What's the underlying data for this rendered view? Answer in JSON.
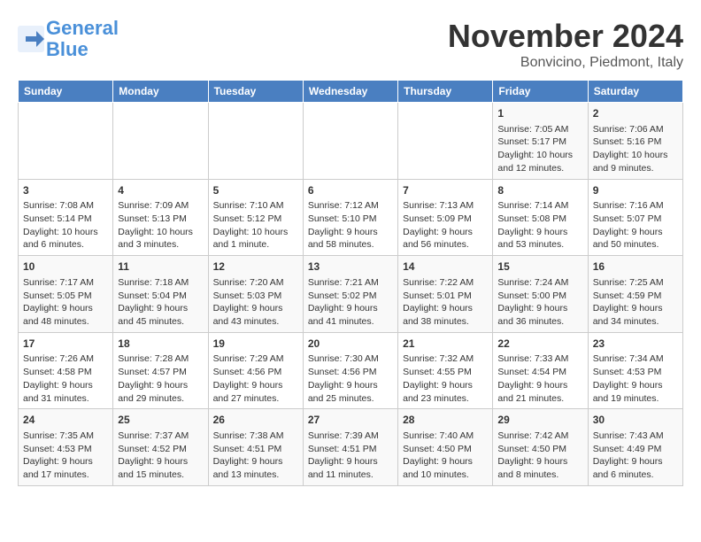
{
  "header": {
    "logo_line1": "General",
    "logo_line2": "Blue",
    "title": "November 2024",
    "subtitle": "Bonvicino, Piedmont, Italy"
  },
  "weekdays": [
    "Sunday",
    "Monday",
    "Tuesday",
    "Wednesday",
    "Thursday",
    "Friday",
    "Saturday"
  ],
  "weeks": [
    [
      {
        "day": "",
        "info": ""
      },
      {
        "day": "",
        "info": ""
      },
      {
        "day": "",
        "info": ""
      },
      {
        "day": "",
        "info": ""
      },
      {
        "day": "",
        "info": ""
      },
      {
        "day": "1",
        "info": "Sunrise: 7:05 AM\nSunset: 5:17 PM\nDaylight: 10 hours and 12 minutes."
      },
      {
        "day": "2",
        "info": "Sunrise: 7:06 AM\nSunset: 5:16 PM\nDaylight: 10 hours and 9 minutes."
      }
    ],
    [
      {
        "day": "3",
        "info": "Sunrise: 7:08 AM\nSunset: 5:14 PM\nDaylight: 10 hours and 6 minutes."
      },
      {
        "day": "4",
        "info": "Sunrise: 7:09 AM\nSunset: 5:13 PM\nDaylight: 10 hours and 3 minutes."
      },
      {
        "day": "5",
        "info": "Sunrise: 7:10 AM\nSunset: 5:12 PM\nDaylight: 10 hours and 1 minute."
      },
      {
        "day": "6",
        "info": "Sunrise: 7:12 AM\nSunset: 5:10 PM\nDaylight: 9 hours and 58 minutes."
      },
      {
        "day": "7",
        "info": "Sunrise: 7:13 AM\nSunset: 5:09 PM\nDaylight: 9 hours and 56 minutes."
      },
      {
        "day": "8",
        "info": "Sunrise: 7:14 AM\nSunset: 5:08 PM\nDaylight: 9 hours and 53 minutes."
      },
      {
        "day": "9",
        "info": "Sunrise: 7:16 AM\nSunset: 5:07 PM\nDaylight: 9 hours and 50 minutes."
      }
    ],
    [
      {
        "day": "10",
        "info": "Sunrise: 7:17 AM\nSunset: 5:05 PM\nDaylight: 9 hours and 48 minutes."
      },
      {
        "day": "11",
        "info": "Sunrise: 7:18 AM\nSunset: 5:04 PM\nDaylight: 9 hours and 45 minutes."
      },
      {
        "day": "12",
        "info": "Sunrise: 7:20 AM\nSunset: 5:03 PM\nDaylight: 9 hours and 43 minutes."
      },
      {
        "day": "13",
        "info": "Sunrise: 7:21 AM\nSunset: 5:02 PM\nDaylight: 9 hours and 41 minutes."
      },
      {
        "day": "14",
        "info": "Sunrise: 7:22 AM\nSunset: 5:01 PM\nDaylight: 9 hours and 38 minutes."
      },
      {
        "day": "15",
        "info": "Sunrise: 7:24 AM\nSunset: 5:00 PM\nDaylight: 9 hours and 36 minutes."
      },
      {
        "day": "16",
        "info": "Sunrise: 7:25 AM\nSunset: 4:59 PM\nDaylight: 9 hours and 34 minutes."
      }
    ],
    [
      {
        "day": "17",
        "info": "Sunrise: 7:26 AM\nSunset: 4:58 PM\nDaylight: 9 hours and 31 minutes."
      },
      {
        "day": "18",
        "info": "Sunrise: 7:28 AM\nSunset: 4:57 PM\nDaylight: 9 hours and 29 minutes."
      },
      {
        "day": "19",
        "info": "Sunrise: 7:29 AM\nSunset: 4:56 PM\nDaylight: 9 hours and 27 minutes."
      },
      {
        "day": "20",
        "info": "Sunrise: 7:30 AM\nSunset: 4:56 PM\nDaylight: 9 hours and 25 minutes."
      },
      {
        "day": "21",
        "info": "Sunrise: 7:32 AM\nSunset: 4:55 PM\nDaylight: 9 hours and 23 minutes."
      },
      {
        "day": "22",
        "info": "Sunrise: 7:33 AM\nSunset: 4:54 PM\nDaylight: 9 hours and 21 minutes."
      },
      {
        "day": "23",
        "info": "Sunrise: 7:34 AM\nSunset: 4:53 PM\nDaylight: 9 hours and 19 minutes."
      }
    ],
    [
      {
        "day": "24",
        "info": "Sunrise: 7:35 AM\nSunset: 4:53 PM\nDaylight: 9 hours and 17 minutes."
      },
      {
        "day": "25",
        "info": "Sunrise: 7:37 AM\nSunset: 4:52 PM\nDaylight: 9 hours and 15 minutes."
      },
      {
        "day": "26",
        "info": "Sunrise: 7:38 AM\nSunset: 4:51 PM\nDaylight: 9 hours and 13 minutes."
      },
      {
        "day": "27",
        "info": "Sunrise: 7:39 AM\nSunset: 4:51 PM\nDaylight: 9 hours and 11 minutes."
      },
      {
        "day": "28",
        "info": "Sunrise: 7:40 AM\nSunset: 4:50 PM\nDaylight: 9 hours and 10 minutes."
      },
      {
        "day": "29",
        "info": "Sunrise: 7:42 AM\nSunset: 4:50 PM\nDaylight: 9 hours and 8 minutes."
      },
      {
        "day": "30",
        "info": "Sunrise: 7:43 AM\nSunset: 4:49 PM\nDaylight: 9 hours and 6 minutes."
      }
    ]
  ]
}
